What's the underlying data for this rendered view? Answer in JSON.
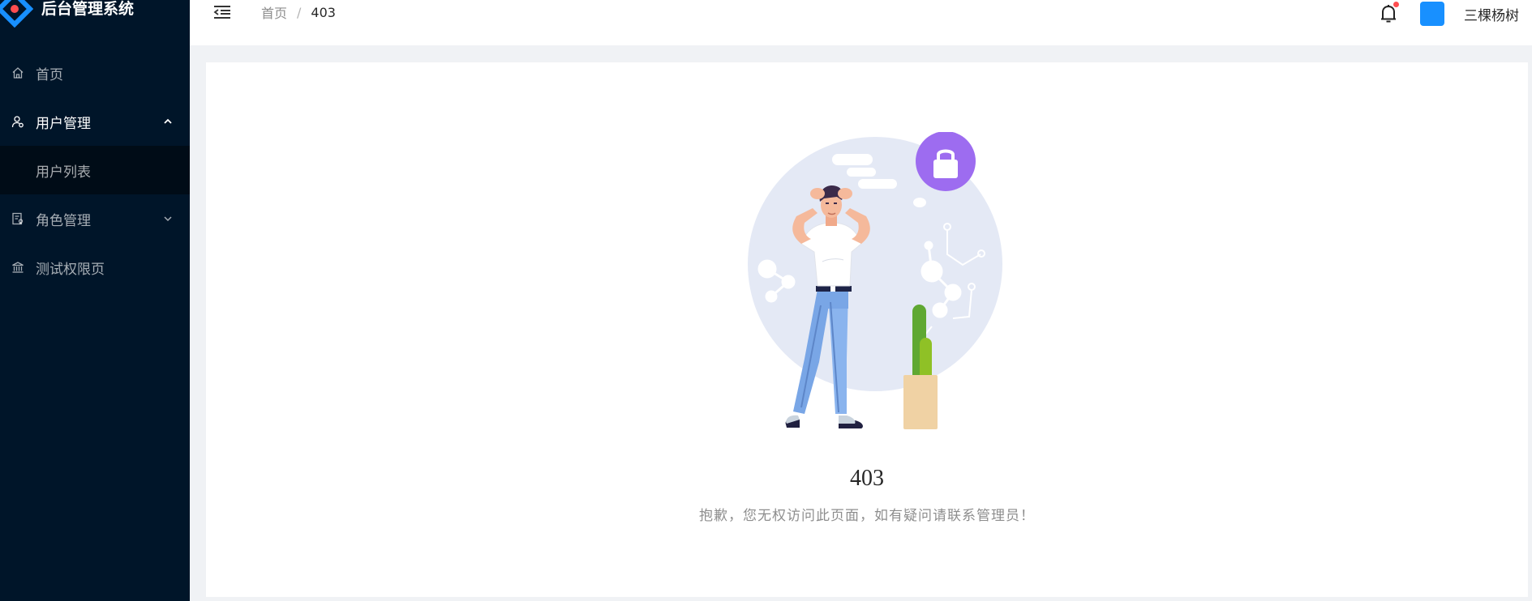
{
  "app": {
    "title": "后台管理系统"
  },
  "sidebar": {
    "items": [
      {
        "label": "首页",
        "icon": "home-icon"
      },
      {
        "label": "用户管理",
        "icon": "user-icon",
        "expanded": true,
        "children": [
          {
            "label": "用户列表"
          }
        ]
      },
      {
        "label": "角色管理",
        "icon": "role-icon",
        "expanded": false
      },
      {
        "label": "测试权限页",
        "icon": "bank-icon"
      }
    ]
  },
  "header": {
    "breadcrumb": [
      "首页",
      "403"
    ],
    "breadcrumb_separator": "/",
    "username": "三棵杨树",
    "has_notification": true
  },
  "result": {
    "status": "403",
    "message": "抱歉，您无权访问此页面，如有疑问请联系管理员！"
  },
  "colors": {
    "sidebar_bg": "#001529",
    "submenu_bg": "#000c17",
    "accent": "#1890ff",
    "badge": "#ff4d4f",
    "lock": "#9d6cf0"
  }
}
